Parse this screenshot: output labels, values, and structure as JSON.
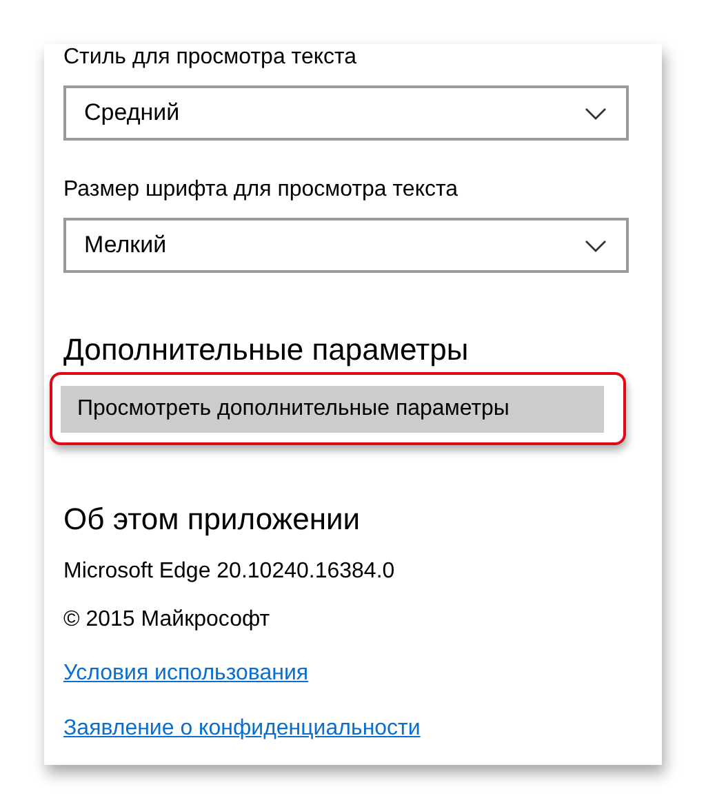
{
  "reading": {
    "style_label": "Стиль для просмотра текста",
    "style_value": "Средний",
    "size_label": "Размер шрифта для просмотра текста",
    "size_value": "Мелкий"
  },
  "advanced": {
    "heading": "Дополнительные параметры",
    "button": "Просмотреть дополнительные параметры",
    "highlighted": true
  },
  "about": {
    "heading": "Об этом приложении",
    "version": "Microsoft Edge 20.10240.16384.0",
    "copyright": "© 2015 Майкрософт",
    "links": [
      "Условия использования",
      "Заявление о конфиденциальности"
    ]
  }
}
